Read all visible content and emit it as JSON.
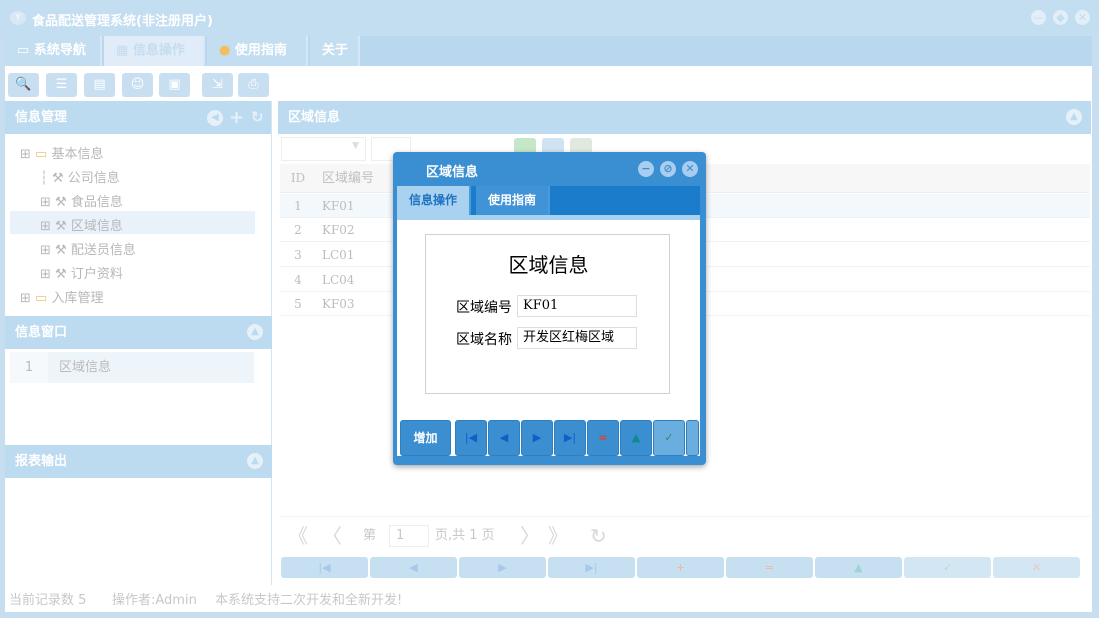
{
  "window": {
    "title": "食品配送管理系统(非注册用户)",
    "logo": "Y"
  },
  "tabs": [
    {
      "label": "系统导航",
      "icon": "monitor-icon"
    },
    {
      "label": "信息操作",
      "icon": "grid-icon"
    },
    {
      "label": "使用指南",
      "icon": "help-icon"
    },
    {
      "label": "关于"
    }
  ],
  "left": {
    "info_mgmt": {
      "title": "信息管理",
      "tree": [
        {
          "label": "基本信息",
          "level": 0
        },
        {
          "label": "公司信息",
          "level": 1
        },
        {
          "label": "食品信息",
          "level": 1
        },
        {
          "label": "区域信息",
          "level": 1,
          "selected": true
        },
        {
          "label": "配送员信息",
          "level": 1
        },
        {
          "label": "订户资料",
          "level": 1
        },
        {
          "label": "入库管理",
          "level": 0
        }
      ]
    },
    "info_window": {
      "title": "信息窗口",
      "rows": [
        {
          "num": "1",
          "label": "区域信息"
        }
      ]
    },
    "report": {
      "title": "报表输出"
    }
  },
  "right": {
    "title": "区域信息",
    "grid": {
      "headers": [
        "ID",
        "区域编号"
      ],
      "rows": [
        [
          "1",
          "KF01"
        ],
        [
          "2",
          "KF02"
        ],
        [
          "3",
          "LC01"
        ],
        [
          "4",
          "LC04"
        ],
        [
          "5",
          "KF03"
        ]
      ]
    },
    "pager": {
      "first": "《",
      "prev": "〈",
      "page_label": "第",
      "page": "1",
      "total": "页,共 1 页",
      "next": "〉",
      "last": "》",
      "refresh": "↻"
    },
    "buttons": [
      "|◀",
      "◀",
      "▶",
      "▶|",
      "+",
      "=",
      "▲",
      "✓",
      "✕"
    ]
  },
  "status": {
    "records": "当前记录数 5",
    "operator": "操作者:Admin",
    "note": "本系统支持二次开发和全新开发!"
  },
  "modal": {
    "title": "区域信息",
    "tabs": [
      "信息操作",
      "使用指南"
    ],
    "form_title": "区域信息",
    "fields": [
      {
        "label": "区域编号",
        "value": "KF01"
      },
      {
        "label": "区域名称",
        "value": "开发区红梅区域"
      }
    ],
    "add_label": "增加",
    "nav": [
      "|◀",
      "◀",
      "▶",
      "▶|",
      "=",
      "▲",
      "✓"
    ]
  }
}
